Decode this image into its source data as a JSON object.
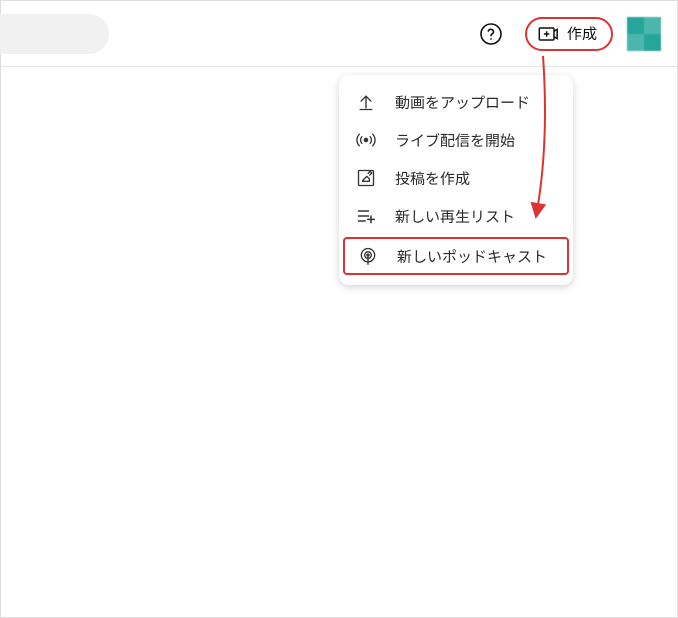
{
  "topbar": {
    "help_tooltip": "ヘルプ",
    "create_label": "作成"
  },
  "menu": {
    "items": [
      {
        "icon": "upload-icon",
        "label": "動画をアップロード"
      },
      {
        "icon": "live-icon",
        "label": "ライブ配信を開始"
      },
      {
        "icon": "post-icon",
        "label": "投稿を作成"
      },
      {
        "icon": "playlist-icon",
        "label": "新しい再生リスト"
      },
      {
        "icon": "podcast-icon",
        "label": "新しいポッドキャスト"
      }
    ]
  },
  "annotation": {
    "highlight_create": true,
    "highlight_menu_index": 4,
    "arrow_color": "#d33"
  }
}
